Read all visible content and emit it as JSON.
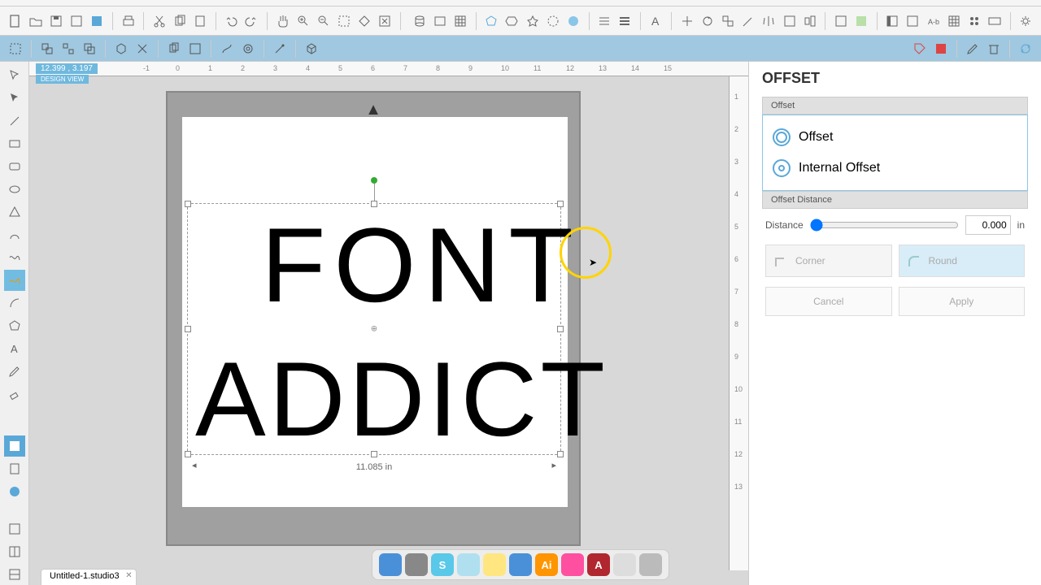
{
  "coords": "12.399 , 3.197",
  "view_label": "DESIGN VIEW",
  "doc_tab": "Untitled-1.studio3",
  "canvas": {
    "line1": "FONT",
    "line2": "ADDICT",
    "dim_label": "11.085 in"
  },
  "ruler_h": [
    "-1",
    "0",
    "1",
    "2",
    "3",
    "4",
    "5",
    "6",
    "7",
    "8",
    "9",
    "10",
    "11",
    "12",
    "13",
    "14",
    "15"
  ],
  "ruler_v": [
    "1",
    "2",
    "3",
    "4",
    "5",
    "6",
    "7",
    "8",
    "9",
    "10",
    "11",
    "12",
    "13"
  ],
  "panel": {
    "title": "OFFSET",
    "section_offset": "Offset",
    "opt_offset": "Offset",
    "opt_internal": "Internal Offset",
    "section_distance": "Offset Distance",
    "distance_label": "Distance",
    "distance_value": "0.000",
    "distance_unit": "in",
    "corner_label": "Corner",
    "round_label": "Round",
    "cancel": "Cancel",
    "apply": "Apply"
  },
  "dock_items": [
    {
      "bg": "#4a90d9",
      "fg": "#fff",
      "glyph": ""
    },
    {
      "bg": "#888",
      "fg": "#fff",
      "glyph": ""
    },
    {
      "bg": "#5ac8e8",
      "fg": "#fff",
      "glyph": "S"
    },
    {
      "bg": "#b0e0f0",
      "fg": "#333",
      "glyph": ""
    },
    {
      "bg": "#ffe680",
      "fg": "#333",
      "glyph": ""
    },
    {
      "bg": "#4a90d9",
      "fg": "#fff",
      "glyph": ""
    },
    {
      "bg": "#ff9500",
      "fg": "#fff",
      "glyph": "Ai"
    },
    {
      "bg": "#ff4fa0",
      "fg": "#fff",
      "glyph": ""
    },
    {
      "bg": "#b0272f",
      "fg": "#fff",
      "glyph": "A"
    },
    {
      "bg": "#ddd",
      "fg": "#333",
      "glyph": ""
    },
    {
      "bg": "#bbb",
      "fg": "#333",
      "glyph": ""
    }
  ]
}
